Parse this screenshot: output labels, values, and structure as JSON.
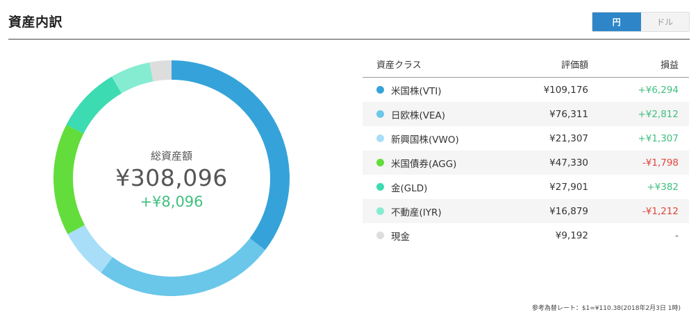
{
  "header": {
    "title": "資産内訳",
    "currency": {
      "active": "円",
      "inactive": "ドル"
    }
  },
  "summary": {
    "label": "総資産額",
    "total": "¥308,096",
    "profit": "+¥8,096"
  },
  "table": {
    "headers": {
      "name": "資産クラス",
      "value": "評価額",
      "gain": "損益"
    },
    "rows": [
      {
        "name": "米国株(VTI)",
        "value": "¥109,176",
        "gain": "+¥6,294",
        "sign": "pos",
        "color": "#35a3d9"
      },
      {
        "name": "日欧株(VEA)",
        "value": "¥76,311",
        "gain": "+¥2,812",
        "sign": "pos",
        "color": "#6ac7ea"
      },
      {
        "name": "新興国株(VWO)",
        "value": "¥21,307",
        "gain": "+¥1,307",
        "sign": "pos",
        "color": "#a8def7"
      },
      {
        "name": "米国債券(AGG)",
        "value": "¥47,330",
        "gain": "-¥1,798",
        "sign": "neg",
        "color": "#63dd3c"
      },
      {
        "name": "金(GLD)",
        "value": "¥27,901",
        "gain": "+¥382",
        "sign": "pos",
        "color": "#3cdbb2"
      },
      {
        "name": "不動産(IYR)",
        "value": "¥16,879",
        "gain": "-¥1,212",
        "sign": "neg",
        "color": "#85ecd1"
      },
      {
        "name": "現金",
        "value": "¥9,192",
        "gain": "-",
        "sign": "none",
        "color": "#dddddd"
      }
    ],
    "note": "参考為替レート：$1=¥110.38(2018年2月3日 1時)"
  },
  "chart_data": {
    "type": "pie",
    "title": "",
    "categories": [
      "米国株(VTI)",
      "日欧株(VEA)",
      "新興国株(VWO)",
      "米国債券(AGG)",
      "金(GLD)",
      "不動産(IYR)",
      "現金"
    ],
    "values": [
      109176,
      76311,
      21307,
      47330,
      27901,
      16879,
      9192
    ],
    "colors": [
      "#35a3d9",
      "#6ac7ea",
      "#a8def7",
      "#63dd3c",
      "#3cdbb2",
      "#85ecd1",
      "#dddddd"
    ]
  }
}
